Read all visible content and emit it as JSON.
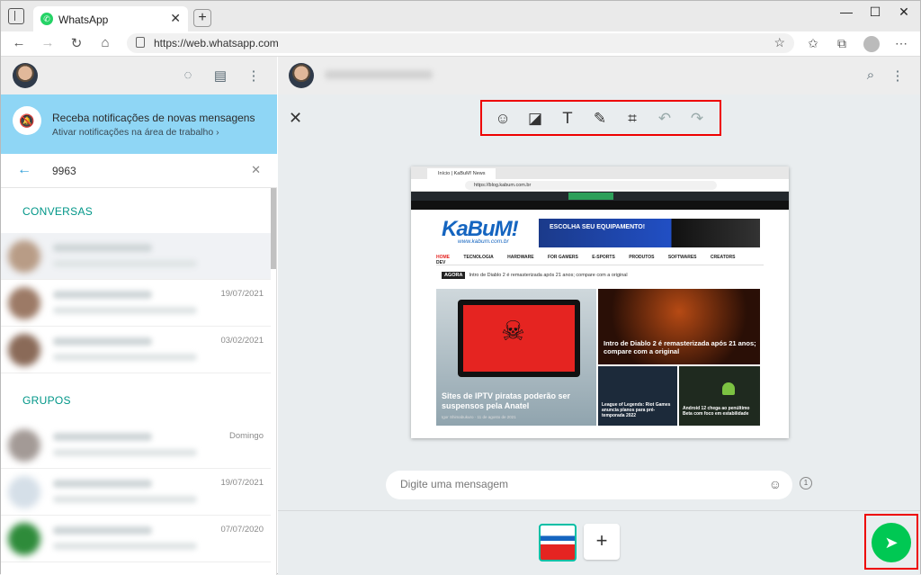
{
  "browser": {
    "tab_title": "WhatsApp",
    "url": "https://web.whatsapp.com"
  },
  "notification": {
    "title": "Receba notificações de novas mensagens",
    "subtitle": "Ativar notificações na área de trabalho ›"
  },
  "search": {
    "value": "9963"
  },
  "sections": {
    "conversations": "CONVERSAS",
    "groups": "GRUPOS"
  },
  "chats": [
    {
      "date": ""
    },
    {
      "date": "19/07/2021"
    },
    {
      "date": "03/02/2021"
    }
  ],
  "groups": [
    {
      "date": "Domingo"
    },
    {
      "date": "19/07/2021"
    },
    {
      "date": "07/07/2020"
    }
  ],
  "composer": {
    "placeholder": "Digite uma mensagem",
    "count": "1"
  },
  "preview": {
    "tab": "Início | KaBuM! News",
    "url": "https://blog.kabum.com.br",
    "logo": "KaBuM!",
    "logo_sub": "www.kabum.com.br",
    "banner": "ESCOLHA SEU EQUIPAMENTO!",
    "nav": [
      "HOME",
      "TECNOLOGIA",
      "HARDWARE",
      "FOR GAMERS",
      "E-SPORTS",
      "PRODUTOS",
      "SOFTWARES",
      "CREATORS",
      "DEV"
    ],
    "ticker_label": "AGORA",
    "ticker": "Intro de Diablo 2 é remasterizada após 21 anos; compare com a original",
    "main_caption": "Sites de IPTV piratas poderão ser suspensos pela Anatel",
    "main_meta": "Igor Shimabukuro · 11 de agosto de 2021",
    "side1_caption": "Intro de Diablo 2 é remasterizada após 21 anos; compare com a original",
    "side2_caption": "League of Legends: Riot Games anuncia planos para pré-temporada 2022",
    "side3_caption": "Android 12 chega ao penúltimo Beta com foco em estabilidade"
  },
  "colors": {
    "accent": "#00c853",
    "notification_bg": "#8fd6f5",
    "highlight": "#e00000"
  }
}
